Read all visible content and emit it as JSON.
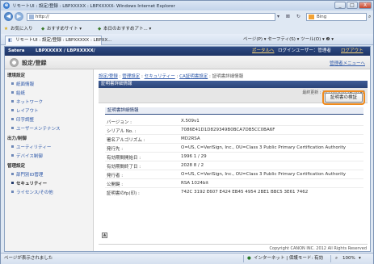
{
  "window": {
    "title": "リモートUI : 設定/登録 : LBPXXXXX : LBPXXXXX- Windows Internet Explorer",
    "min": "_",
    "max": "□",
    "close": "X"
  },
  "addressbar": {
    "url": "http://",
    "search_placeholder": "Bing"
  },
  "favbar": {
    "favorites": "お気に入り",
    "suggested": "おすすめサイト ▾",
    "web_slice": "本日のおすすめアト... ▾"
  },
  "tabbar": {
    "tab_label": "リモートUI : 設定/登録 : LBPXXXXX : LBPXX...",
    "tools": "ページ(P) ▾  セーフティ(S) ▾  ツール(O) ▾  ❷ ▾"
  },
  "app": {
    "brand": "Satera",
    "model": "LBPXXXXX / LBPXXXXX/",
    "portal_link": "ポータルへ",
    "login_user": "ログインユーザー：管理者",
    "logout_link": "ログアウト",
    "page_heading": "設定/登録",
    "admin_menu_link": "管理者メニューへ"
  },
  "sidebar": {
    "sections": [
      {
        "heading": "環境設定",
        "items": [
          "紙面情報",
          "給紙",
          "ネットワーク",
          "レイアウト",
          "印字調整",
          "ユーザーメンテナンス"
        ]
      },
      {
        "heading": "出力/制御",
        "items": [
          "ユーティリティー",
          "デバイス制御"
        ]
      },
      {
        "heading": "管理設定",
        "items": [
          "部門別ID管理",
          "セキュリティー",
          "ライセンス/その他"
        ]
      }
    ]
  },
  "breadcrumb": {
    "items": [
      "設定/登録",
      "管理設定",
      "セキュリティー",
      "CA証明書設定"
    ],
    "current": "証明書詳細情報"
  },
  "main": {
    "page_title": "証明書詳細情報",
    "last_updated": "最終更新 : 2011/03/28 14:10:42",
    "verify_button": "証明書の検証",
    "section_title": "証明書詳細情報",
    "rows": [
      {
        "label": "バージョン :",
        "value": "X.509v1"
      },
      {
        "label": "シリアル No. :",
        "value": "7086E41D1D829349B0BCA7DB5CC0BA6F"
      },
      {
        "label": "署名アルゴリズム :",
        "value": "MD2RSA"
      },
      {
        "label": "発行先 :",
        "value": "O=US, C=VeriSign, Inc., OU=Class 3 Public Primary Certification Authority"
      },
      {
        "label": "有効期間開始日 :",
        "value": "1996 1 / 29"
      },
      {
        "label": "有効期間終了日 :",
        "value": "2028 8 / 2"
      },
      {
        "label": "発行者 :",
        "value": "O=US, C=VeriSign, Inc., OU=Class 3 Public Primary Certification Authority"
      },
      {
        "label": "公開鍵 :",
        "value": "RSA 1024bit"
      },
      {
        "label": "証明書のfp(印) :",
        "value": "742C 3192 E607 E424 EB45 4954 2BE1 BBC5 3E61 7462"
      }
    ],
    "copyright": "Copyright CANON INC. 2012 All Rights Reserved"
  },
  "statusbar": {
    "left": "ページが表示されました",
    "zone": "インターネット | 保護モード: 有効",
    "zoom": "100%"
  },
  "colors": {
    "accent_highlight": "#f08a1c",
    "brand_bar": "#1f3566",
    "link": "#2b56a8"
  }
}
